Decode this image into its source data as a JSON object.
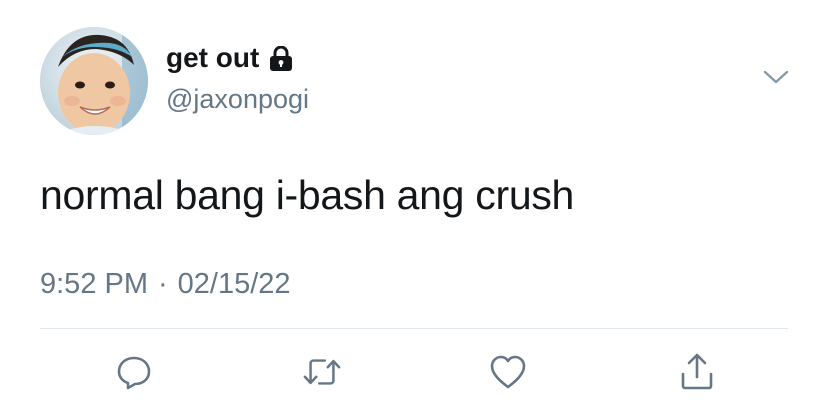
{
  "tweet": {
    "display_name": "get out",
    "handle": "@jaxonpogi",
    "text": "normal bang i-bash ang crush",
    "time": "9:52 PM",
    "separator": "·",
    "date": "02/15/22",
    "protected": true
  },
  "icons": {
    "lock": "lock-icon",
    "caret": "chevron-down-icon",
    "reply": "reply-icon",
    "retweet": "retweet-icon",
    "like": "heart-icon",
    "share": "share-icon"
  },
  "colors": {
    "text_primary": "#14171a",
    "text_secondary": "#657786",
    "icon": "#657786",
    "divider": "#e1e8ed"
  }
}
